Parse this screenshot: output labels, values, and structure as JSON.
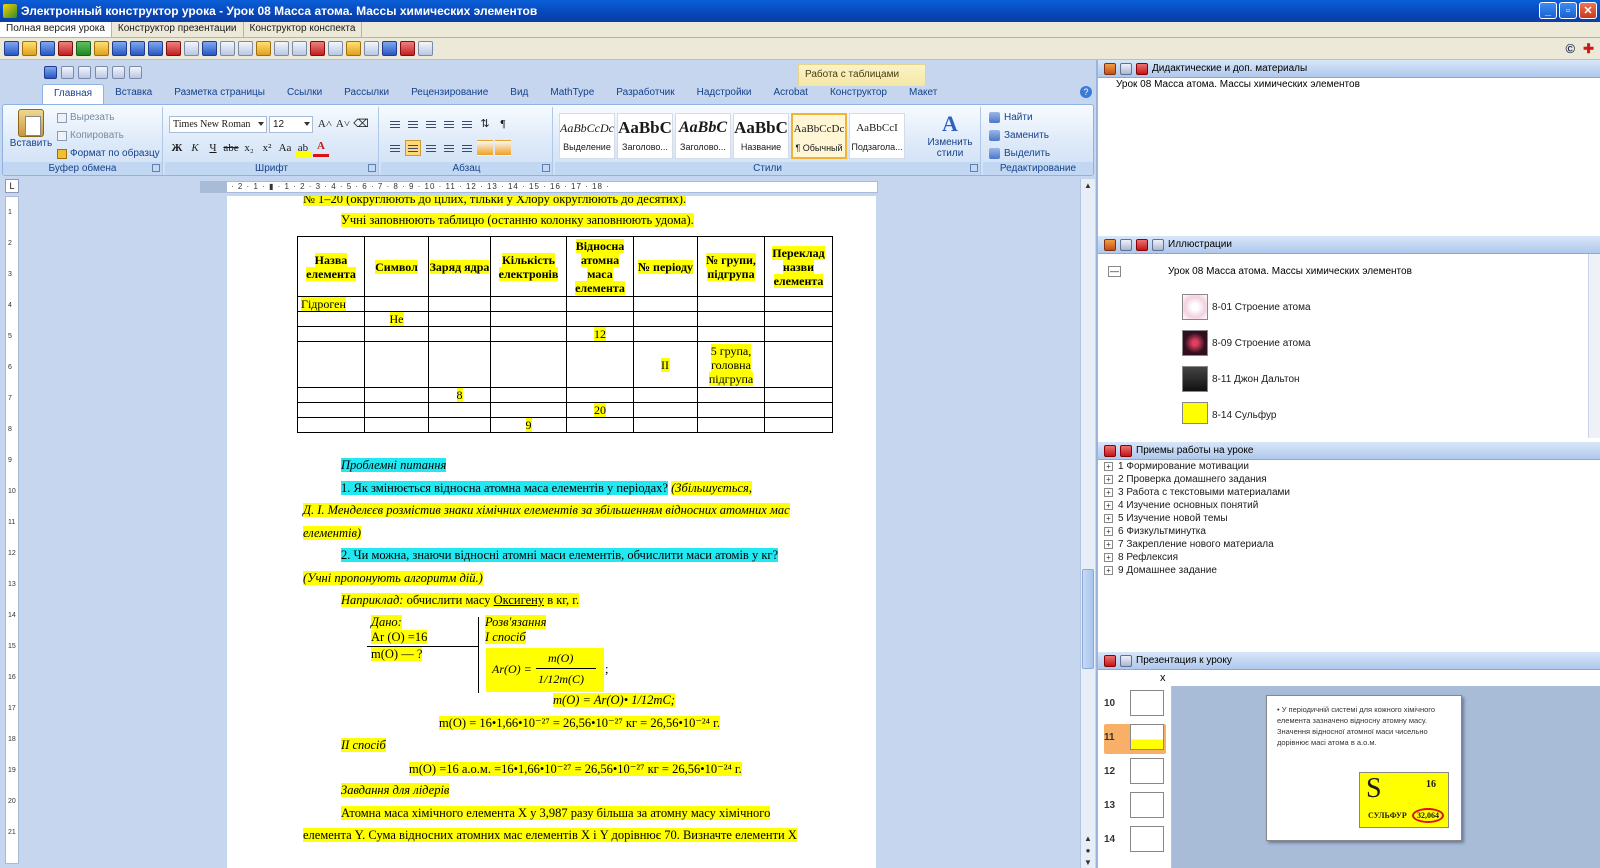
{
  "window": {
    "title": "Электронный конструктор урока - Урок 08 Масса атома. Массы химических элементов",
    "buttons": [
      "_",
      "▫",
      "✕"
    ]
  },
  "mode_tabs": [
    "Полная версия урока",
    "Конструктор презентации",
    "Конструктор конспекта"
  ],
  "app_toolbar": {
    "copyright": "©",
    "plus": "✚"
  },
  "ribbon": {
    "context_label": "Работа с таблицами",
    "tabs": [
      "Главная",
      "Вставка",
      "Разметка страницы",
      "Ссылки",
      "Рассылки",
      "Рецензирование",
      "Вид",
      "MathType",
      "Разработчик",
      "Надстройки",
      "Acrobat",
      "Конструктор",
      "Макет"
    ],
    "clipboard": {
      "paste": "Вставить",
      "cut": "Вырезать",
      "copy": "Копировать",
      "format_painter": "Формат по образцу",
      "title": "Буфер обмена"
    },
    "font": {
      "name": "Times New Roman",
      "size": "12",
      "bold": "Ж",
      "italic": "К",
      "underline": "Ч",
      "strike": "abe",
      "sub": "x₂",
      "sup": "x²",
      "case": "Aa",
      "color": "A",
      "grow": "A˄",
      "shrink": "A˅",
      "title": "Шрифт"
    },
    "paragraph": {
      "title": "Абзац",
      "pilcrow": "¶",
      "sort": "⇅"
    },
    "styles": {
      "items": [
        {
          "sample": "AaBbCcDc",
          "name": "Выделение"
        },
        {
          "sample": "AaBbC",
          "name": "Заголово..."
        },
        {
          "sample": "AaBbC",
          "name": "Заголово..."
        },
        {
          "sample": "AaBbC",
          "name": "Название"
        },
        {
          "sample": "AaBbCcDc",
          "name": "¶ Обычный"
        },
        {
          "sample": "AaBbCcI",
          "name": "Подзагола..."
        }
      ],
      "change": "Изменить стили",
      "change_glyph": "A",
      "title": "Стили"
    },
    "editing": {
      "find": "Найти",
      "replace": "Заменить",
      "select": "Выделить",
      "title": "Редактирование"
    }
  },
  "ruler": "· 2 · 1 · ▮ · 1 · 2 · 3 · 4 · 5 · 6 · 7 · 8 · 9 · 10 · 11 · 12 · 13 · 14 · 15 · 16 · 17 · 18 ·",
  "vruler_labels": [
    "1",
    "2",
    "3",
    "4",
    "5",
    "6",
    "7",
    "8",
    "9",
    "10",
    "11",
    "12",
    "13",
    "14",
    "15",
    "16",
    "17",
    "18",
    "19",
    "20",
    "21"
  ],
  "document": {
    "line_top": "№ 1–20 (округлюють до цілих, тільки у Хлору округлюють до десятих).",
    "intro": "Учні заповнюють таблицю (останню колонку заповнюють удома).",
    "table": {
      "headers": [
        "Назва елемента",
        "Символ",
        "Заряд ядра",
        "Кількість електронів",
        "Відносна атомна маса елемента",
        "№ періоду",
        "№ групи, підгрупа",
        "Переклад назви елемента"
      ],
      "rows": [
        [
          "Гідроген",
          "",
          "",
          "",
          "",
          "",
          "",
          ""
        ],
        [
          "",
          "He",
          "",
          "",
          "",
          "",
          "",
          ""
        ],
        [
          "",
          "",
          "",
          "",
          "12",
          "",
          "",
          ""
        ],
        [
          "",
          "",
          "",
          "",
          "",
          "II",
          "5 група, головна підгрупа",
          ""
        ],
        [
          "",
          "",
          "8",
          "",
          "",
          "",
          "",
          ""
        ],
        [
          "",
          "",
          "",
          "",
          "20",
          "",
          "",
          ""
        ],
        [
          "",
          "",
          "",
          "9",
          "",
          "",
          "",
          ""
        ]
      ]
    },
    "problems_title": "Проблемні питання",
    "q1_a": "1.  Як  змінюється  відносна  атомна  маса  елементів  у  періодах?",
    "q1_b": "(Збільшується,",
    "q1_c": "Д. І. Менделєєв розмістив знаки хімічних елементів за збільшенням відносних атомних мас",
    "q1_d": "елементів)",
    "q2_a": "2.  Чи  можна,  знаючи  відносні  атомні  маси  елементів,  обчислити  маси  атомів  у  кг?",
    "q2_b": "(Учні пропонують алгоритм дій.)",
    "example_a": "Наприклад:",
    "example_b": "обчислити масу",
    "example_c": "Оксигену",
    "example_d": "в кг, г.",
    "given": "Дано:",
    "given_ar": "Ar (O) =16",
    "given_m": "m(O) — ?",
    "solution": "Розв'язання",
    "method1": "І спосіб",
    "formula_lhs": "Ar(O) =",
    "formula_num": "m(O)",
    "formula_den": "1/12m(C)",
    "formula_end": ";",
    "eq1": "m(O) = Ar(O)• 1/12mC;",
    "eq2": "m(O) = 16•1,66•10⁻²⁷ = 26,56•10⁻²⁷ кг = 26,56•10⁻²⁴ г.",
    "method2": "ІІ спосіб",
    "eq3": "m(O) =16 а.о.м. =16•1,66•10⁻²⁷ =  26,56•10⁻²⁷ кг = 26,56•10⁻²⁴ г.",
    "leaders": "Завдання для лідерів",
    "task_a": "Атомна  маса  хімічного  елемента  Х  у  3,987  разу  більша  за  атомну  масу  хімічного",
    "task_b": "елемента  Y.  Сума  відносних  атомних  мас  елементів  X і Y дорівнює  70.  Визначте  елементи  X"
  },
  "right_panel": {
    "didactic": {
      "title": "Дидактические и доп. материалы",
      "item": "Урок 08 Масса атома. Массы химических элементов"
    },
    "illustrations": {
      "title": "Иллюстрации",
      "root": "Урок 08 Масса атома. Массы химических элементов",
      "collapse": "—",
      "items": [
        "8-01 Строение атома",
        "8-09 Строение атома",
        "8-11 Джон Дальтон",
        "8-14 Сульфур"
      ]
    },
    "methods": {
      "title": "Приемы работы на уроке",
      "expander": "+",
      "items": [
        "1 Формирование мотивации",
        "2 Проверка домашнего задания",
        "3 Работа с текстовыми материалами",
        "4 Изучение основных понятий",
        "5 Изучение новой темы",
        "6 Физкультминутка",
        "7 Закрепление нового материала",
        "8 Рефлексия",
        "9 Домашнее задание"
      ]
    },
    "presentation": {
      "title": "Презентация к уроку",
      "close": "x",
      "slides": [
        "10",
        "11",
        "12",
        "13",
        "14"
      ],
      "slide_text": "• У періодичній системі для кожного хімічного елемента зазначено відносну атомну масу. Значення відносної атомної маси чисельно дорівнює масі атома в а.о.м.",
      "element": {
        "symbol": "S",
        "number": "16",
        "name": "СУЛЬФУР",
        "mass": "32,064"
      }
    }
  }
}
